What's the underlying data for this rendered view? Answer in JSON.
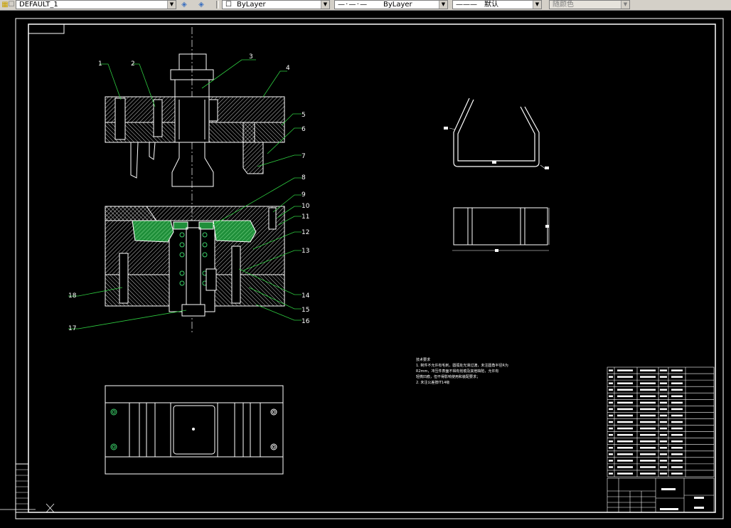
{
  "toolbar": {
    "layer_value": "DEFAULT_1",
    "color_value": "ByLayer",
    "linetype_value": "ByLayer",
    "lineweight_value": "默认",
    "plotstyle_value": "随颜色"
  },
  "part_labels": [
    "1",
    "2",
    "3",
    "4",
    "5",
    "6",
    "7",
    "8",
    "9",
    "10",
    "11",
    "12",
    "13",
    "14",
    "15",
    "16",
    "17",
    "18"
  ],
  "tech_notes": {
    "title": "技术要求",
    "lines": [
      "1. 制件不允许有毛刺，圆弧处光滑过渡，未注圆角半径R为",
      "   R2mm，冲压件表面不得有划痕及其他缺陷，允许有",
      "   轻微凹痕，但不得影响使用和装配要求；",
      "2. 未注公差按IT14级"
    ]
  },
  "bom": {
    "rows": 17
  },
  "colors": {
    "background": "#000000",
    "lines": "#ffffff",
    "leaders": "#00ff00",
    "hatch": "#ffffff",
    "green_part": "#1f8f3a"
  }
}
